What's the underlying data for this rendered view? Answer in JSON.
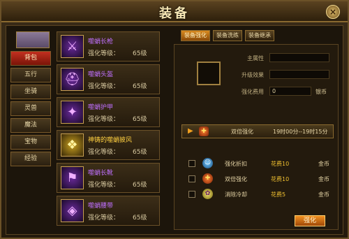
{
  "window": {
    "title": "装备",
    "close_label": "×"
  },
  "nav": {
    "items": [
      {
        "label": "背包",
        "active": true
      },
      {
        "label": "五行"
      },
      {
        "label": "坐骑"
      },
      {
        "label": "灵兽"
      },
      {
        "label": "魔法"
      },
      {
        "label": "宝物"
      },
      {
        "label": "经验"
      }
    ]
  },
  "equipment": {
    "items": [
      {
        "name": "噬蛸长枪",
        "level_label": "强化等级：",
        "level_value": "65级",
        "icon": "spear-icon",
        "rarity": "purple"
      },
      {
        "name": "噬蛸头盔",
        "level_label": "强化等级：",
        "level_value": "65级",
        "icon": "helmet-icon",
        "rarity": "purple"
      },
      {
        "name": "噬蛸护甲",
        "level_label": "强化等级：",
        "level_value": "65级",
        "icon": "armor-icon",
        "rarity": "purple"
      },
      {
        "name": "神铸的噬蛸披风",
        "level_label": "强化等级：",
        "level_value": "65级",
        "icon": "cloak-icon",
        "rarity": "gold"
      },
      {
        "name": "噬蛸长靴",
        "level_label": "强化等级：",
        "level_value": "65级",
        "icon": "boots-icon",
        "rarity": "purple"
      },
      {
        "name": "噬蛸腰带",
        "level_label": "强化等级：",
        "level_value": "65级",
        "icon": "belt-icon",
        "rarity": "purple"
      }
    ]
  },
  "tabs": [
    {
      "label": "装备强化",
      "active": true
    },
    {
      "label": "装备洗练"
    },
    {
      "label": "装备继承"
    }
  ],
  "form": {
    "main_attr_label": "主属性",
    "main_attr_value": "",
    "upgrade_label": "升级效果",
    "upgrade_value": "",
    "cost_label": "强化费用",
    "cost_value": "0",
    "cost_unit": "银币"
  },
  "buff": {
    "name": "双倍强化",
    "time": "19时00分--19时15分"
  },
  "options": [
    {
      "name": "强化折扣",
      "cost": "花费10",
      "currency": "金币",
      "icon": "discount-icon"
    },
    {
      "name": "双倍强化",
      "cost": "花费10",
      "currency": "金币",
      "icon": "double-icon"
    },
    {
      "name": "消除冷却",
      "cost": "花费5",
      "currency": "金币",
      "icon": "cooldown-icon"
    }
  ],
  "action": {
    "label": "强化"
  },
  "colors": {
    "active_tab": "#d88a20",
    "active_nav": "#c23020",
    "purple_name": "#c070ff",
    "gold_name": "#ffd040"
  }
}
